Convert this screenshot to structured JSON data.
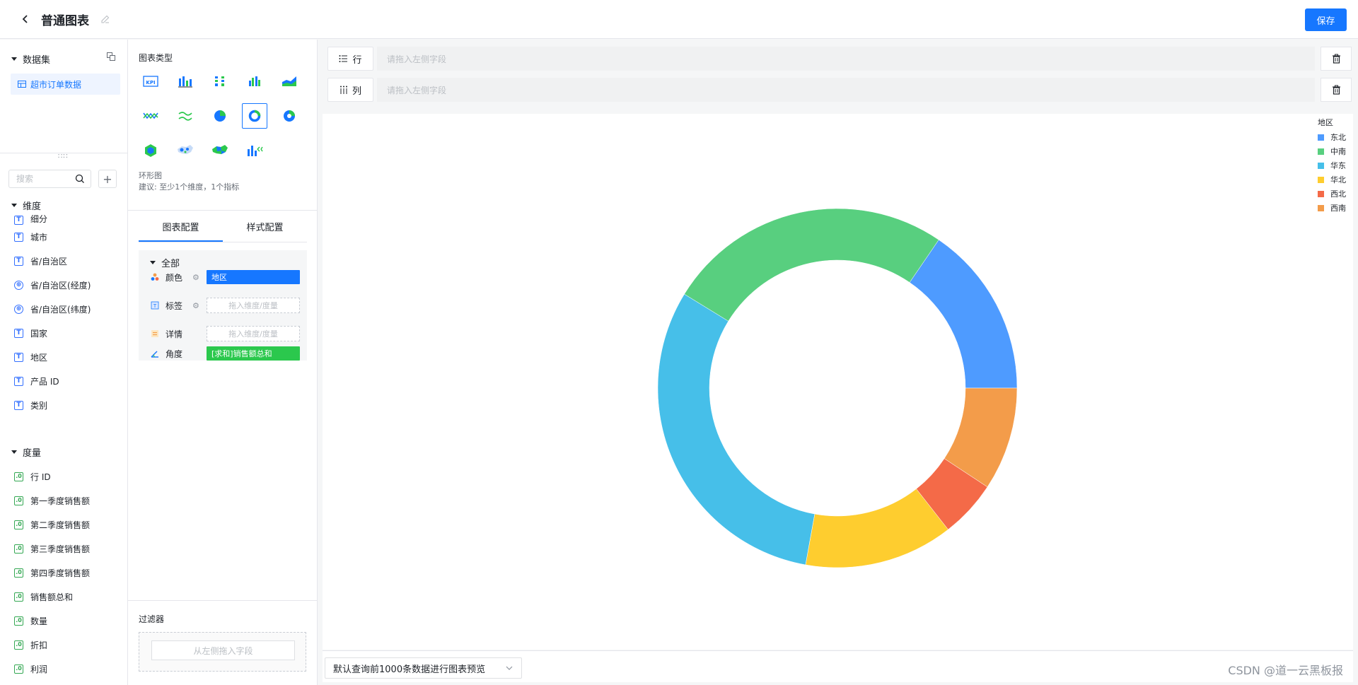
{
  "header": {
    "title": "普通图表",
    "save_label": "保存"
  },
  "dataset": {
    "section_label": "数据集",
    "selected": "超市订单数据"
  },
  "search": {
    "placeholder": "搜索",
    "add_label": "+"
  },
  "dimensions": {
    "section_label": "维度",
    "items": [
      {
        "icon": "text-type-icon",
        "label": "细分"
      },
      {
        "icon": "text-type-icon",
        "label": "城市"
      },
      {
        "icon": "text-type-icon",
        "label": "省/自治区"
      },
      {
        "icon": "geo-type-icon",
        "label": "省/自治区(经度)"
      },
      {
        "icon": "geo-type-icon",
        "label": "省/自治区(纬度)"
      },
      {
        "icon": "text-type-icon",
        "label": "国家"
      },
      {
        "icon": "text-type-icon",
        "label": "地区"
      },
      {
        "icon": "text-type-icon",
        "label": "产品 ID"
      },
      {
        "icon": "text-type-icon",
        "label": "类别"
      }
    ]
  },
  "measures": {
    "section_label": "度量",
    "items": [
      {
        "icon": "number-type-icon",
        "label": "行 ID"
      },
      {
        "icon": "number-type-icon",
        "label": "第一季度销售额"
      },
      {
        "icon": "number-type-icon",
        "label": "第二季度销售额"
      },
      {
        "icon": "number-type-icon",
        "label": "第三季度销售额"
      },
      {
        "icon": "number-type-icon",
        "label": "第四季度销售额"
      },
      {
        "icon": "number-type-icon",
        "label": "销售额总和"
      },
      {
        "icon": "number-type-icon",
        "label": "数量"
      },
      {
        "icon": "number-type-icon",
        "label": "折扣"
      },
      {
        "icon": "number-type-icon",
        "label": "利润"
      }
    ]
  },
  "chart_types": {
    "label": "图表类型",
    "selected_name": "环形图",
    "hint": "建议: 至少1个维度，1个指标",
    "items": [
      "kpi-chart-icon",
      "bar-chart-icon",
      "stacked-bar-icon",
      "grouped-bar-icon",
      "area-chart-icon",
      "line-chart-icon",
      "multi-line-icon",
      "pie-chart-icon",
      "donut-chart-icon",
      "rose-chart-icon",
      "hex-map-icon",
      "scatter-map-icon",
      "region-map-icon",
      "combo-chart-icon"
    ]
  },
  "config": {
    "tab_chart": "图表配置",
    "tab_style": "样式配置",
    "group_label": "全部",
    "color_label": "颜色",
    "color_value": "地区",
    "label_label": "标签",
    "label_placeholder": "拖入维度/度量",
    "detail_label": "详情",
    "detail_placeholder": "拖入维度/度量",
    "angle_label": "角度",
    "angle_value": "[求和]销售额总和"
  },
  "filter": {
    "label": "过滤器",
    "placeholder": "从左侧拖入字段"
  },
  "shelves": {
    "rows_label": "行",
    "rows_placeholder": "请拖入左侧字段",
    "cols_label": "列",
    "cols_placeholder": "请拖入左侧字段"
  },
  "preview": {
    "label": "默认查询前1000条数据进行图表预览"
  },
  "watermark": "CSDN @道一云黑板报",
  "colors": {
    "accent": "#1677ff",
    "green_pill": "#2bc84d"
  },
  "chart_data": {
    "type": "pie",
    "variant": "donut",
    "legend_title": "地区",
    "legend_position": "top-right",
    "categories": [
      "东北",
      "中南",
      "华东",
      "华北",
      "西北",
      "西南"
    ],
    "values": [
      15,
      25,
      30,
      13,
      5,
      9
    ],
    "colors": [
      "#4e9bff",
      "#58cf7f",
      "#46bfe9",
      "#fecd2f",
      "#f46a48",
      "#f39c4a"
    ]
  }
}
